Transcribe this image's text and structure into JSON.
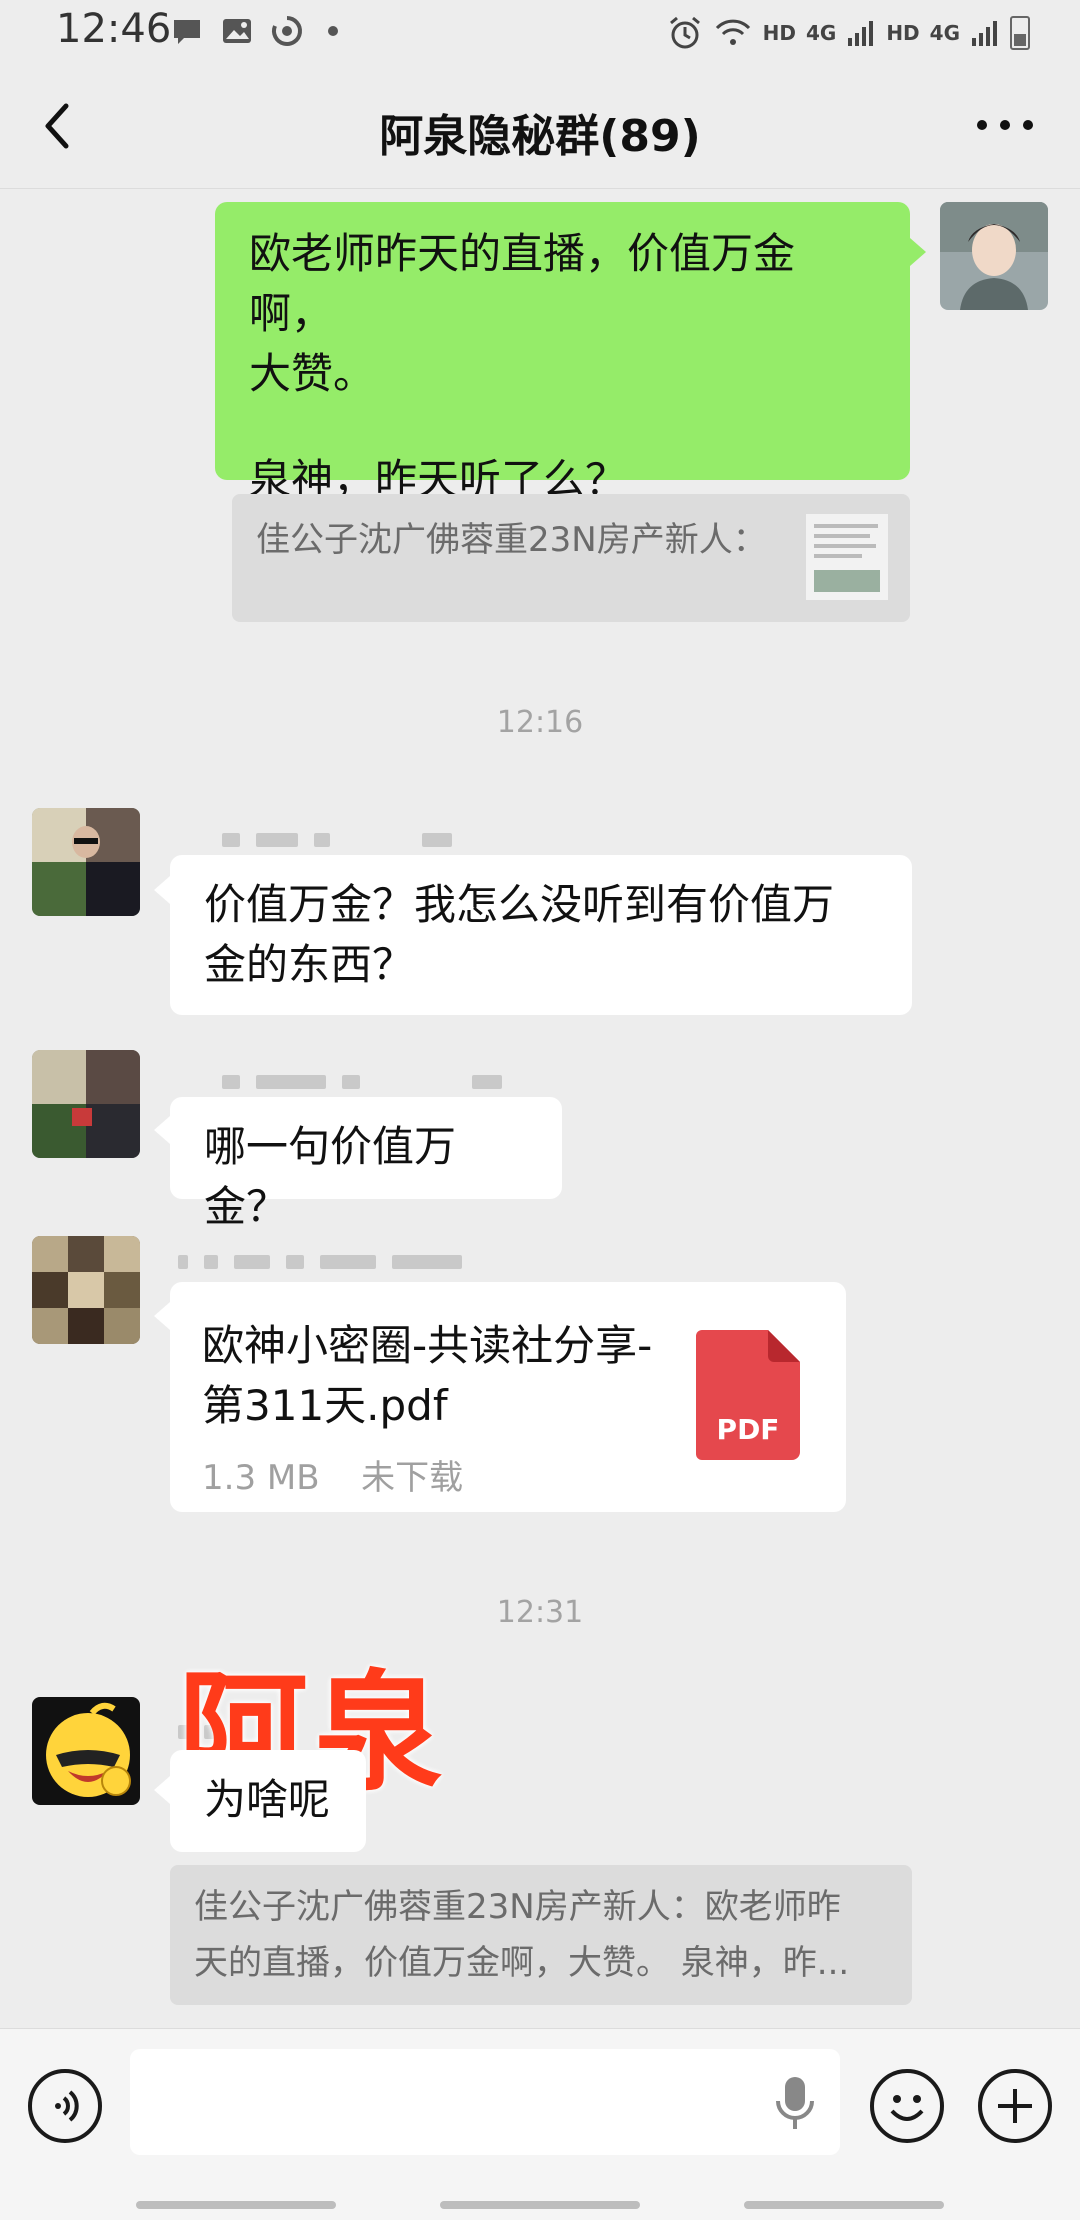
{
  "status_bar": {
    "time": "12:46",
    "hd1": "HD",
    "net1": "4G",
    "hd2": "HD",
    "net2": "4G"
  },
  "header": {
    "title": "阿泉隐秘群(89)"
  },
  "messages": {
    "m1_line1": "欧老师昨天的直播，价值万金啊，",
    "m1_line2": "大赞。",
    "m1_line3": "泉神，昨天听了么？",
    "m1_quote": "佳公子沈广佛蓉重23N房产新人：",
    "time1": "12:16",
    "m2_line1": "价值万金？我怎么没听到有价值万",
    "m2_line2": "金的东西？",
    "m3": "哪一句价值万金？",
    "file_name_line1": "欧神小密圈-共读社分享-",
    "file_name_line2": "第311天.pdf",
    "file_size": "1.3 MB",
    "file_status": "未下载",
    "file_type": "PDF",
    "time2": "12:31",
    "overlay_label": "阿泉",
    "m5": "为啥呢",
    "m5_quote_line1": "佳公子沈广佛蓉重23N房产新人：欧老师昨",
    "m5_quote_line2": "天的直播，价值万金啊，大赞。 泉神，昨..."
  },
  "input_bar": {
    "value": "",
    "icons": [
      "voice-icon",
      "mic-icon",
      "emoji-icon",
      "add-icon"
    ]
  },
  "colors": {
    "my_bubble": "#95ec69",
    "other_bubble": "#ffffff",
    "background": "#ededed",
    "pdf_red": "#e5484d",
    "overlay_red": "#ff3b1a"
  }
}
